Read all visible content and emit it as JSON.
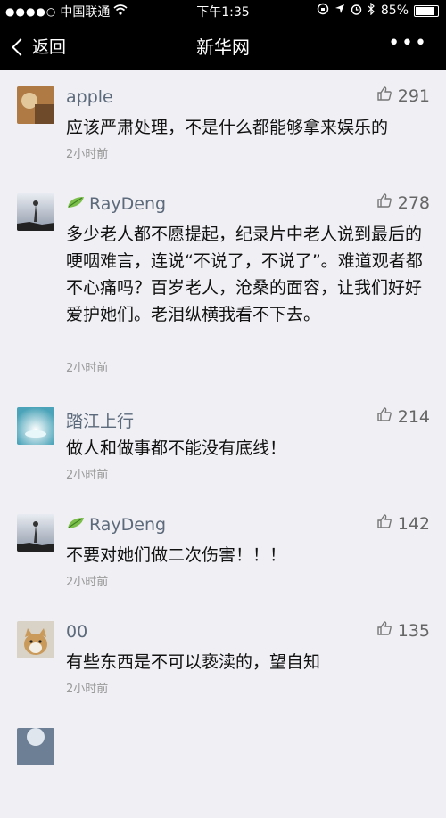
{
  "status_bar": {
    "carrier": "中国联通",
    "time": "下午1:35",
    "battery": "85%",
    "battery_level": 0.85
  },
  "nav": {
    "back_label": "返回",
    "title": "新华网",
    "more_label": "•••"
  },
  "comments": [
    {
      "name": "apple",
      "likes": "291",
      "text": "应该严肃处理，不是什么都能够拿来娱乐的",
      "time": "2小时前"
    },
    {
      "name": "RayDeng",
      "likes": "278",
      "text": "多少老人都不愿提起，纪录片中老人说到最后的哽咽难言，连说“不说了，不说了”。难道观者都不心痛吗？百岁老人，沧桑的面容，让我们好好爱护她们。老泪纵横我看不下去。",
      "time": "2小时前"
    },
    {
      "name": "踏江上行",
      "likes": "214",
      "text": "做人和做事都不能没有底线！",
      "time": "2小时前"
    },
    {
      "name": "RayDeng",
      "likes": "142",
      "text": "不要对她们做二次伤害！！！",
      "time": "2小时前"
    },
    {
      "name": "00",
      "likes": "135",
      "text": "有些东西是不可以亵渎的，望自知",
      "time": "2小时前"
    }
  ]
}
